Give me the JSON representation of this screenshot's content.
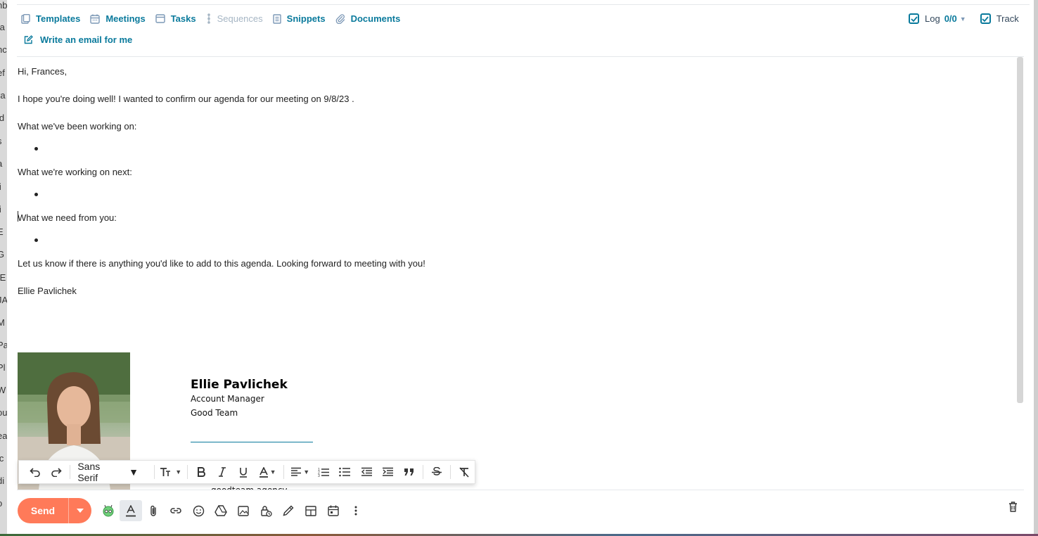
{
  "toolbar": {
    "templates": "Templates",
    "meetings": "Meetings",
    "tasks": "Tasks",
    "sequences": "Sequences",
    "snippets": "Snippets",
    "documents": "Documents",
    "write_ai": "Write an email for me",
    "log_label": "Log",
    "log_count": "0/0",
    "track_label": "Track"
  },
  "email": {
    "greeting": "Hi, Frances,",
    "intro": "I hope you're doing well! I wanted to confirm our agenda for our meeting on 9/8/23 .",
    "section1": "What we've been working on:",
    "section2": "What we're working on next:",
    "section3": "What we need from you:",
    "closing": "Let us know if there is anything you'd like to add to this agenda. Looking forward to meeting with you!",
    "sender": "Ellie Pavlichek"
  },
  "signature": {
    "name": "Ellie Pavlichek",
    "title": "Account Manager",
    "company": "Good Team",
    "website": "goodteam.agency"
  },
  "format_toolbar": {
    "font": "Sans Serif"
  },
  "send": {
    "label": "Send"
  },
  "background_letters": [
    "nb",
    "ta",
    "nc",
    "ef",
    "ra",
    "ld",
    "s",
    "a",
    "li",
    "li",
    "E",
    "G",
    "IE",
    "JA",
    "M",
    "Pa",
    "Pl",
    "W",
    "ou",
    "ea",
    "ic",
    "di",
    "o"
  ],
  "colors": {
    "accent": "#0a7a9c",
    "send": "#ff7a59",
    "disabled": "#a6b6c4"
  }
}
